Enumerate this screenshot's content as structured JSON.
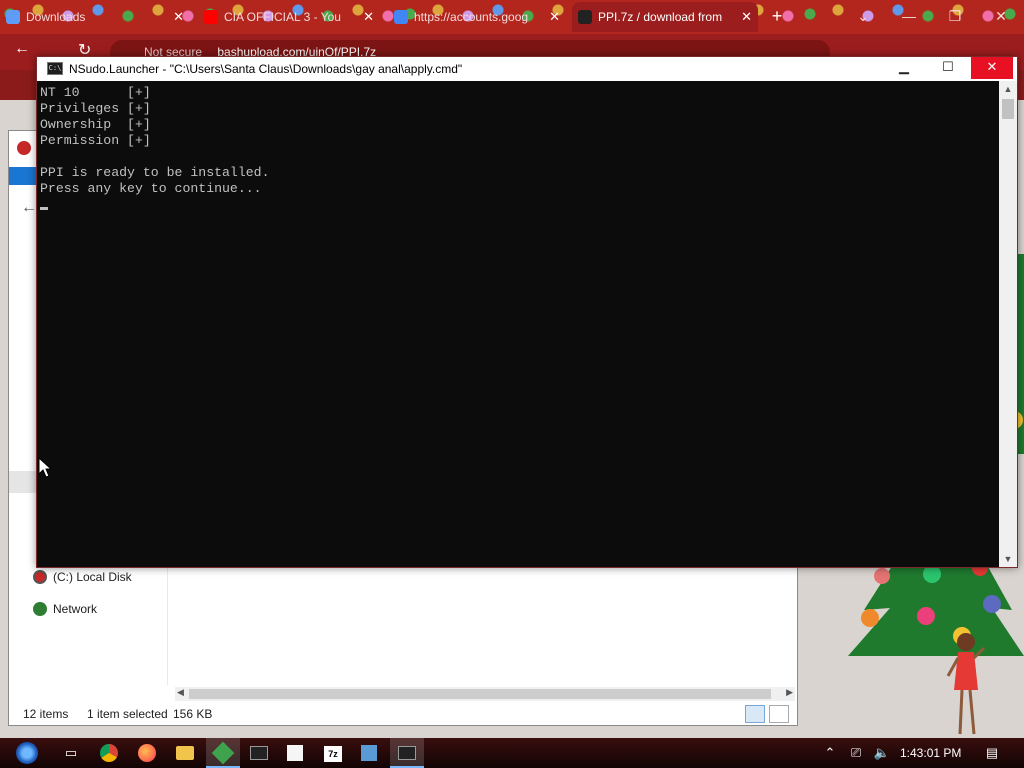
{
  "browser": {
    "tabs": [
      {
        "label": "Downloads",
        "favicon_color": "#5f9cf7"
      },
      {
        "label": "CIA OFFICIAL 3 - You",
        "favicon_color": "#ff0000"
      },
      {
        "label": "https://accounts.goog",
        "favicon_color": "#4285f4"
      },
      {
        "label": "PPI.7z / download from",
        "favicon_color": "#222222"
      }
    ],
    "url_prefix": "Not secure",
    "url_domain": "bashupload.com/uinQf/PPI.7z"
  },
  "explorer": {
    "nav": [
      {
        "label": "(C:) Local Disk",
        "icon": "disk-icon"
      },
      {
        "label": "Network",
        "icon": "network-icon"
      }
    ],
    "status": {
      "items": "12 items",
      "selected": "1 item selected",
      "size": "156 KB"
    }
  },
  "console": {
    "title": "NSudo.Launcher - \"C:\\Users\\Santa Claus\\Downloads\\gay anal\\apply.cmd\"",
    "lines": [
      "NT 10      [+]",
      "Privileges [+]",
      "Ownership  [+]",
      "Permission [+]",
      "",
      "PPI is ready to be installed.",
      "Press any key to continue..."
    ]
  },
  "taskbar": {
    "time": "1:43:01 PM"
  },
  "colors": {
    "browser_frame": "#9c1d1d",
    "console_bg": "#0c0c0c",
    "console_text": "#c0c0c0",
    "close_red": "#e81123"
  }
}
